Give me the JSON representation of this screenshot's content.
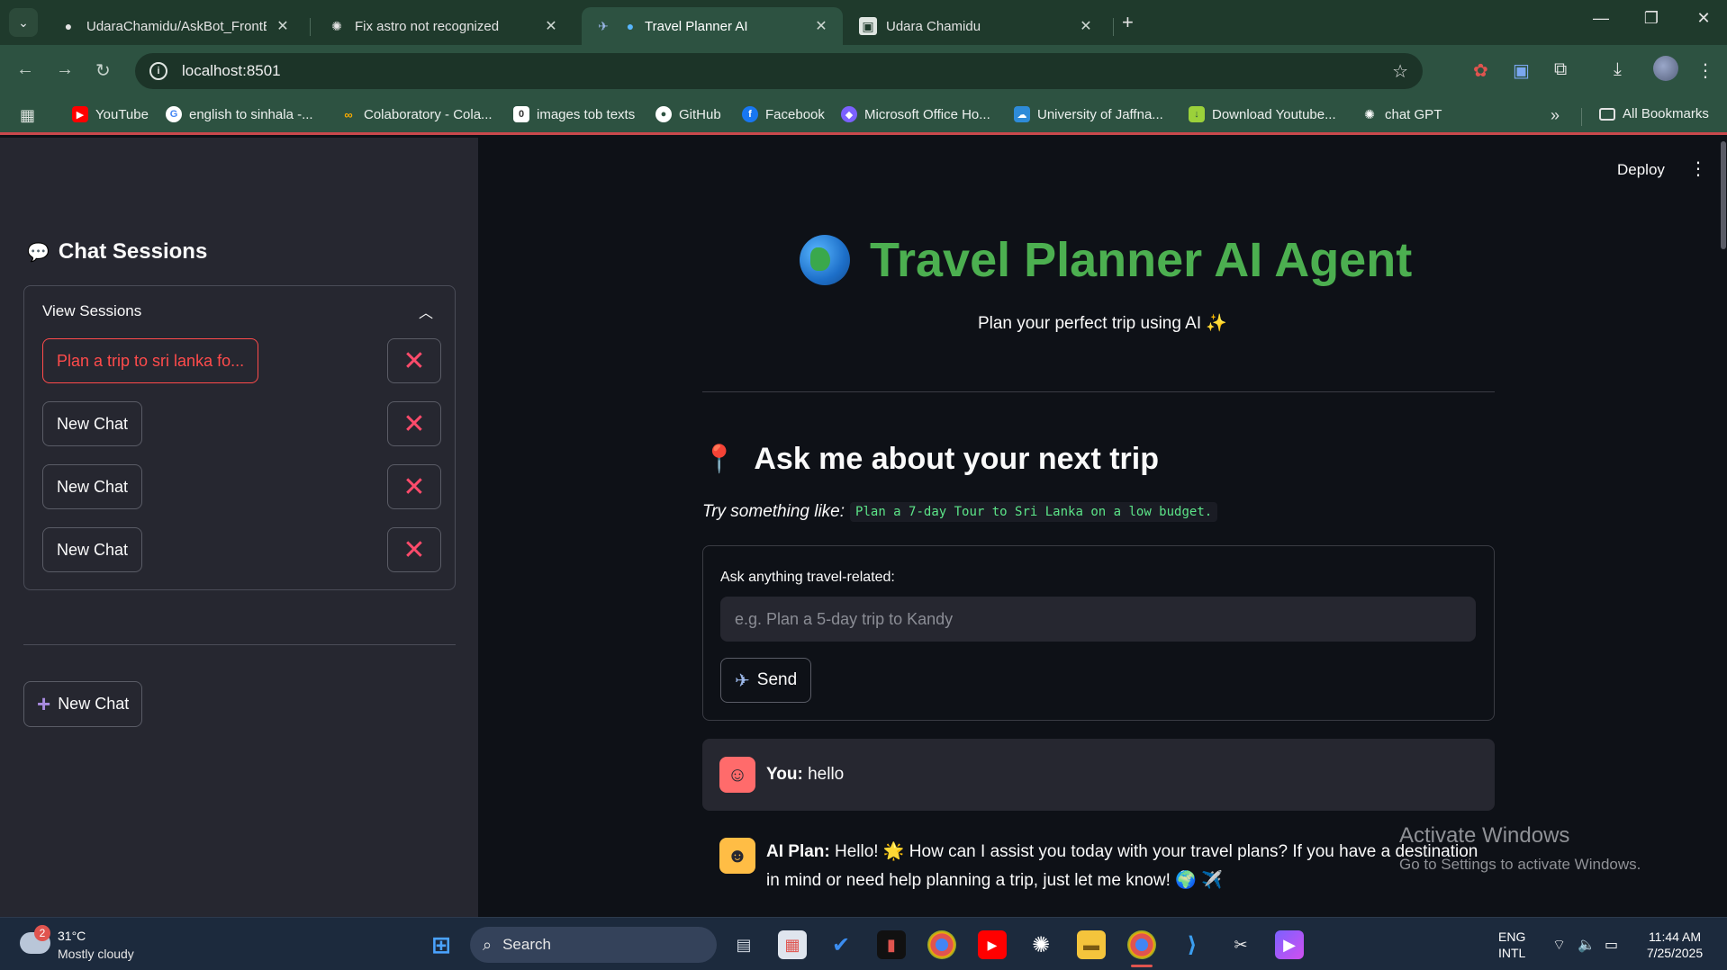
{
  "browser": {
    "tabs": [
      {
        "title": "UdaraChamidu/AskBot_FrontEn",
        "close": "✕"
      },
      {
        "title": "Fix astro not recognized",
        "close": "✕"
      },
      {
        "title": "Travel Planner AI",
        "close": "✕"
      },
      {
        "title": "Udara Chamidu",
        "close": "✕"
      }
    ],
    "url": "localhost:8501",
    "bookmarks": [
      {
        "label": "YouTube",
        "color": "#ff0000"
      },
      {
        "label": "english to sinhala -...",
        "color": "#4285f4"
      },
      {
        "label": "Colaboratory - Cola...",
        "color": "#f9ab00"
      },
      {
        "label": "images tob texts",
        "color": "#ffffff"
      },
      {
        "label": "GitHub",
        "color": "#ffffff"
      },
      {
        "label": "Facebook",
        "color": "#1877f2"
      },
      {
        "label": "Microsoft Office Ho...",
        "color": "#7b61ff"
      },
      {
        "label": "University of Jaffna...",
        "color": "#2e8bd8"
      },
      {
        "label": "Download Youtube...",
        "color": "#9bd13a"
      },
      {
        "label": "chat GPT",
        "color": "#ffffff"
      }
    ],
    "all_bookmarks": "All Bookmarks"
  },
  "sidebar": {
    "title": "Chat Sessions",
    "expander_label": "View Sessions",
    "sessions": [
      {
        "label": "Plan a trip to sri lanka fo...",
        "active": true
      },
      {
        "label": "New Chat",
        "active": false
      },
      {
        "label": "New Chat",
        "active": false
      },
      {
        "label": "New Chat",
        "active": false
      }
    ],
    "new_chat_label": "New Chat"
  },
  "main": {
    "deploy_label": "Deploy",
    "title": "Travel Planner AI Agent",
    "subtitle": "Plan your perfect trip using AI ✨",
    "section_heading": "Ask me about your next trip",
    "try_prefix": "Try something like:",
    "try_example": "Plan a 7-day Tour to Sri Lanka on a low budget.",
    "form": {
      "label": "Ask anything travel-related:",
      "placeholder": "e.g. Plan a 5-day trip to Kandy",
      "value": "",
      "send_label": "Send"
    },
    "messages": [
      {
        "role": "user",
        "prefix": "You:",
        "text": " hello"
      },
      {
        "role": "ai",
        "prefix": "AI Plan:",
        "text": " Hello! 🌟 How can I assist you today with your travel plans? If you have a destination in mind or need help planning a trip, just let me know! 🌍 ✈️"
      }
    ]
  },
  "watermark": {
    "line1": "Activate Windows",
    "line2": "Go to Settings to activate Windows."
  },
  "taskbar": {
    "weather_badge": "2",
    "temperature": "31°C",
    "weather": "Mostly cloudy",
    "search_label": "Search",
    "language": "ENG",
    "layout": "INTL",
    "time": "11:44 AM",
    "date": "7/25/2025"
  },
  "colors": {
    "accent_green": "#4caf50",
    "danger": "#ff4b4b",
    "code_green": "#5ce488",
    "tabbar": "#1f3a2c"
  }
}
